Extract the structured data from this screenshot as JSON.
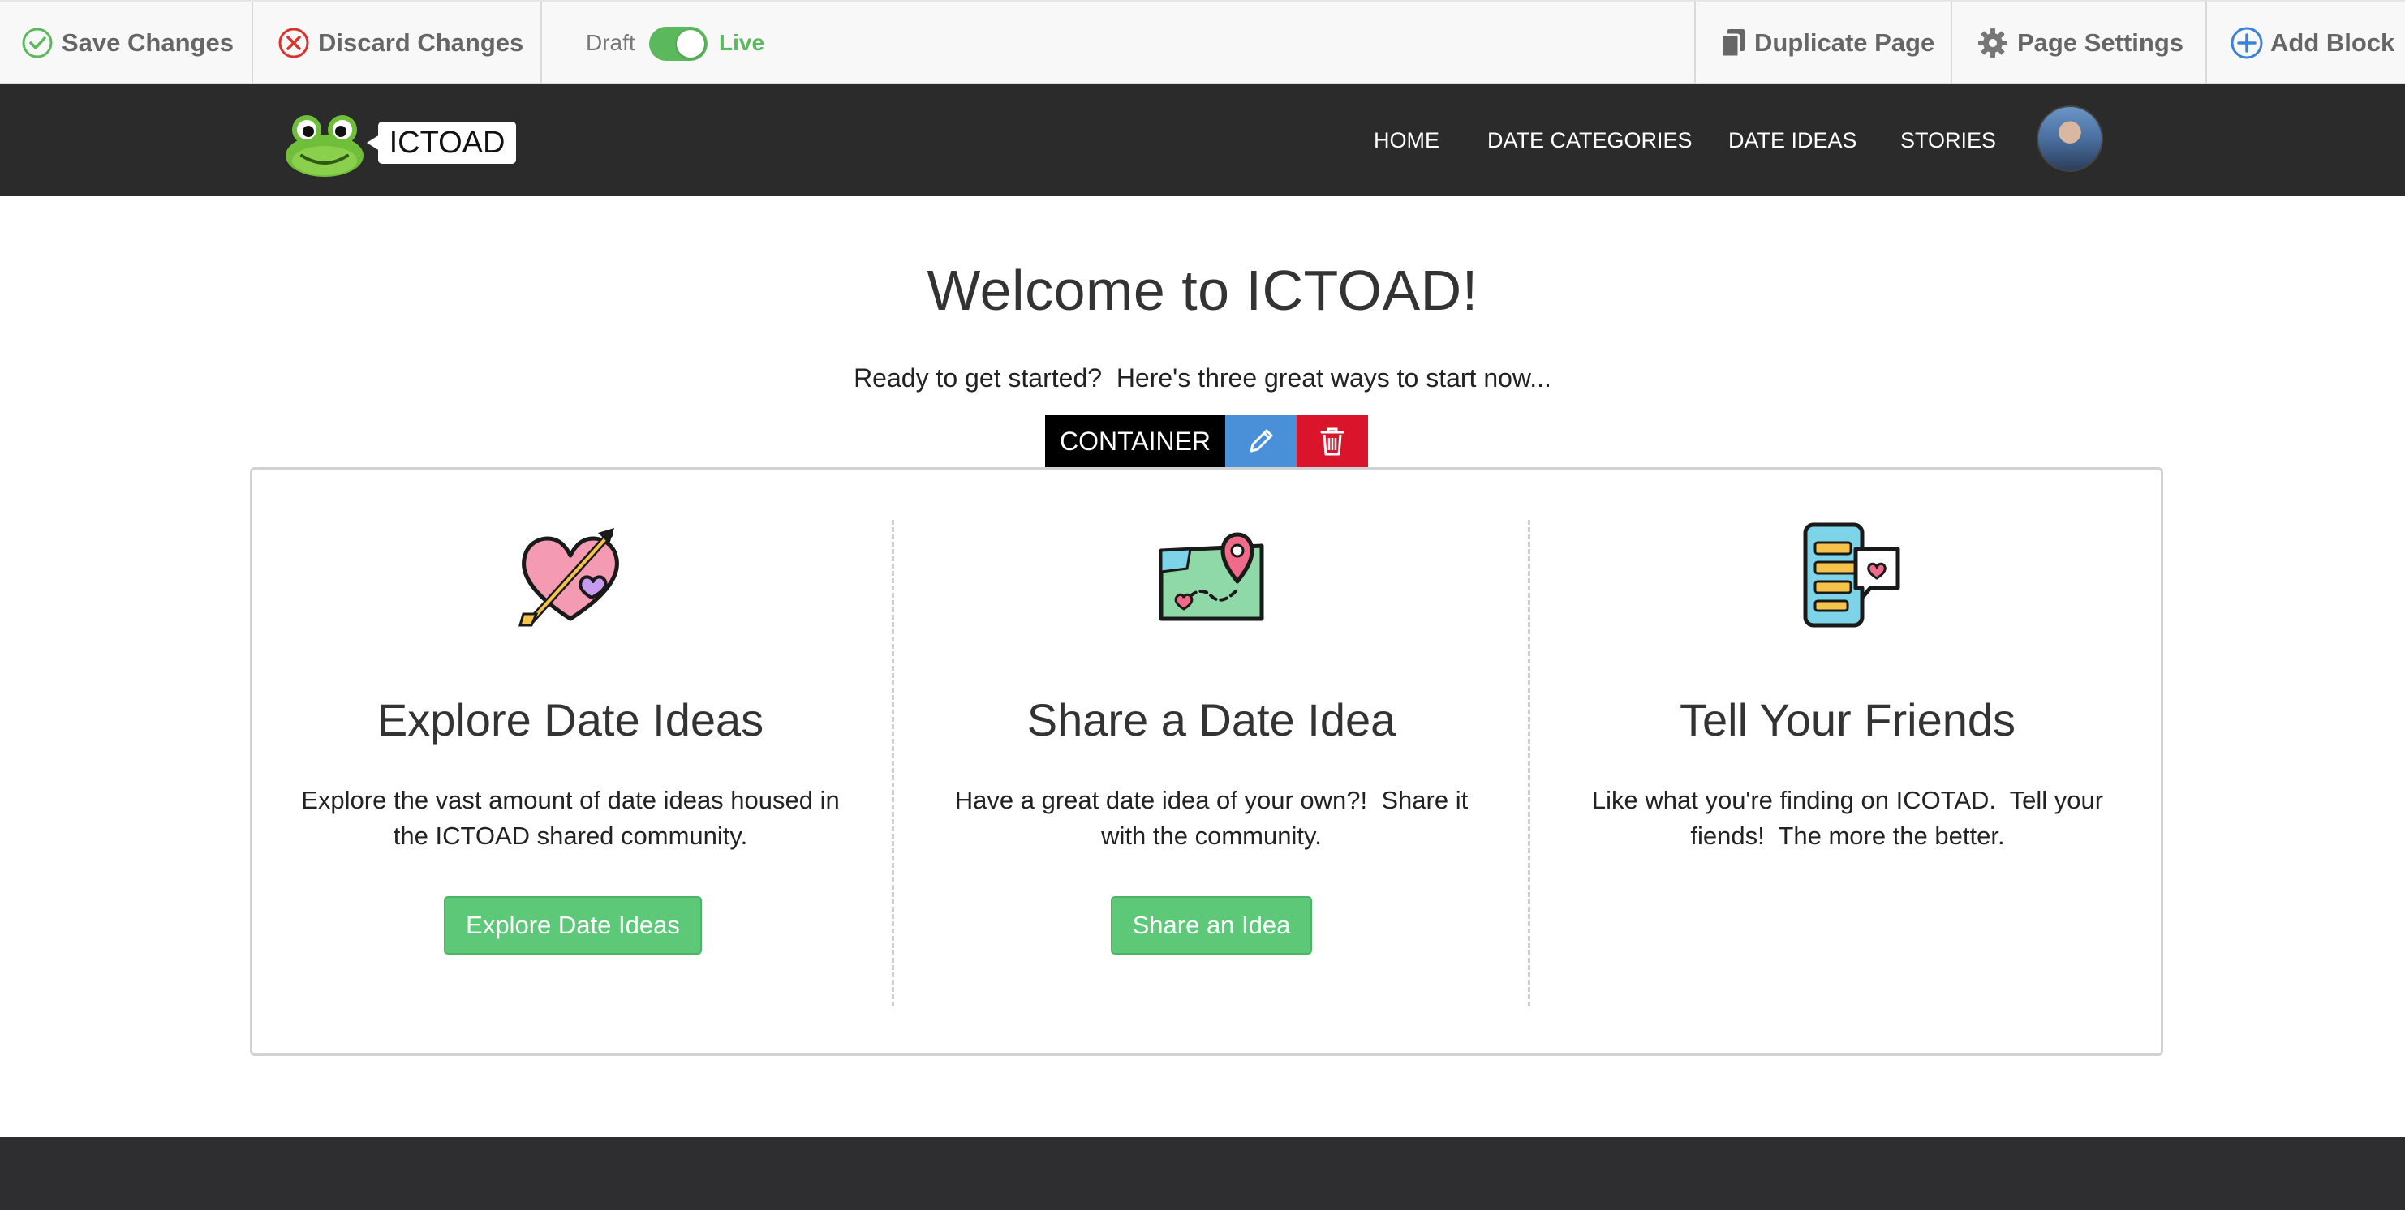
{
  "editor_toolbar": {
    "save_label": "Save Changes",
    "discard_label": "Discard Changes",
    "draft_label": "Draft",
    "live_label": "Live",
    "duplicate_label": "Duplicate Page",
    "settings_label": "Page Settings",
    "add_block_label": "Add Block",
    "publish_state": "live",
    "colors": {
      "save": "#5cb85c",
      "discard": "#d9342b",
      "toggle": "#5cb85c",
      "add": "#3b82d6"
    }
  },
  "site_nav": {
    "logo_text": "ICTOAD",
    "links": [
      {
        "label": "HOME"
      },
      {
        "label": "DATE CATEGORIES"
      },
      {
        "label": "DATE IDEAS"
      },
      {
        "label": "STORIES"
      }
    ],
    "avatar_icon": "user-avatar"
  },
  "main": {
    "title": "Welcome to ICTOAD!",
    "subtitle": "Ready to get started?  Here's three great ways to start now..."
  },
  "container_toolbar": {
    "label": "CONTAINER",
    "edit_icon": "pencil-icon",
    "delete_icon": "trash-icon",
    "colors": {
      "label_bg": "#000000",
      "edit_bg": "#4a90d9",
      "delete_bg": "#d9142b"
    }
  },
  "columns": [
    {
      "icon": "heart-arrow-icon",
      "title": "Explore Date Ideas",
      "text": "Explore the vast amount of date ideas housed in the ICTOAD shared community.",
      "button_label": "Explore Date Ideas"
    },
    {
      "icon": "map-pin-icon",
      "title": "Share a Date Idea",
      "text": "Have a great date idea of your own?!  Share it with the community.",
      "button_label": "Share an Idea"
    },
    {
      "icon": "phone-chat-icon",
      "title": "Tell Your Friends",
      "text": "Like what you're finding on ICOTAD.  Tell your fiends!  The more the better.",
      "button_label": null
    }
  ],
  "accent_color": "#5cc878"
}
